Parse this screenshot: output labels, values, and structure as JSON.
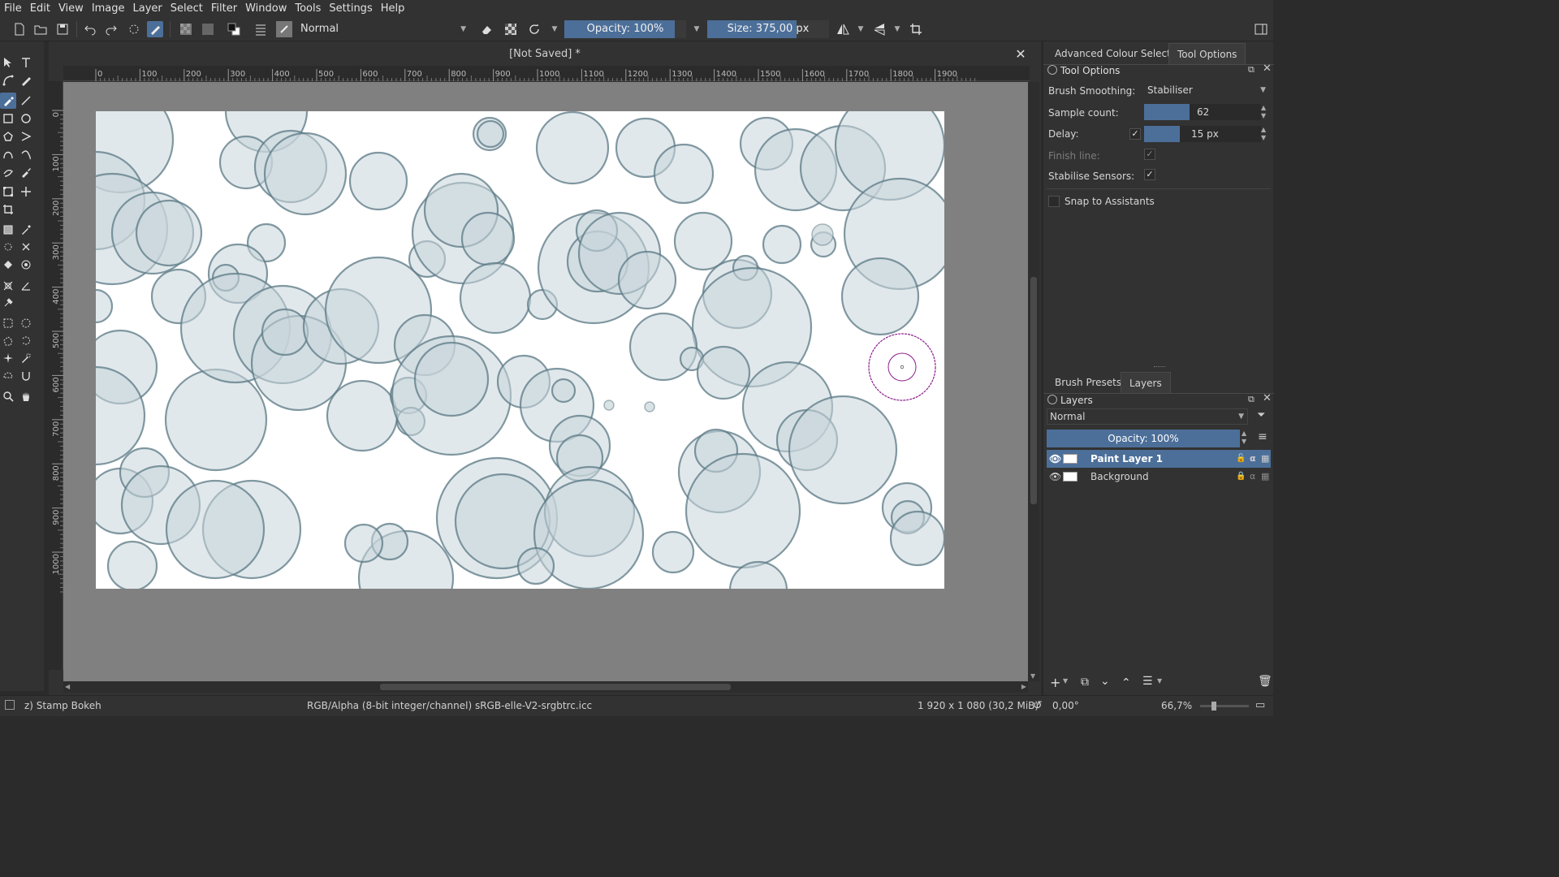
{
  "menubar": {
    "items": [
      "File",
      "Edit",
      "View",
      "Image",
      "Layer",
      "Select",
      "Filter",
      "Window",
      "Tools",
      "Settings",
      "Help"
    ]
  },
  "toolbar": {
    "blend_mode": "Normal",
    "opacity_label": "Opacity: 100%",
    "opacity_value": 1.0,
    "size_label": "Size: 375,00 px",
    "size_value": 375.0
  },
  "document": {
    "tab_title": "[Not Saved]  *",
    "ruler_h_labels": [
      "0",
      "100",
      "200",
      "300",
      "400",
      "500",
      "600",
      "700",
      "800",
      "900",
      "1000",
      "1100",
      "1200",
      "1300",
      "1400",
      "1500",
      "1600",
      "1700",
      "1800",
      "1900"
    ],
    "ruler_v_labels": [
      "0",
      "100",
      "200",
      "300",
      "400",
      "500",
      "600",
      "700",
      "800",
      "900",
      "1000"
    ]
  },
  "tool_options": {
    "tabs": [
      "Advanced Colour Selector",
      "Tool Options"
    ],
    "active_tab": "Tool Options",
    "header": "Tool Options",
    "brush_smoothing_label": "Brush Smoothing:",
    "brush_smoothing_value": "Stabiliser",
    "sample_count_label": "Sample count:",
    "sample_count_value": "62",
    "delay_label": "Delay:",
    "delay_value": "15 px",
    "finish_line_label": "Finish line:",
    "stabilise_sensors_label": "Stabilise Sensors:",
    "snap_label": "Snap to Assistants"
  },
  "layers": {
    "tabs": [
      "Brush Presets",
      "Layers"
    ],
    "active_tab": "Layers",
    "header": "Layers",
    "blend_mode": "Normal",
    "opacity_label": "Opacity:  100%",
    "items": [
      {
        "name": "Paint Layer 1",
        "selected": true
      },
      {
        "name": "Background",
        "selected": false
      }
    ]
  },
  "statusbar": {
    "brush": "z) Stamp Bokeh",
    "color_space": "RGB/Alpha (8-bit integer/channel)  sRGB-elle-V2-srgbtrc.icc",
    "dimensions": "1 920 x 1 080 (30,2 MiB)",
    "rotation": "0,00°",
    "zoom": "66,7%"
  },
  "colors": {
    "accent": "#4c6f99",
    "bubble_fill": "#c7d3d8",
    "bubble_stroke": "#5d7a86",
    "cursor": "#8b1e8b"
  }
}
